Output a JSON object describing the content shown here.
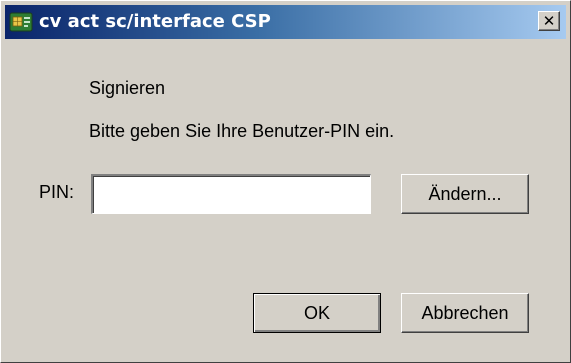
{
  "window": {
    "title": "cv act sc/interface CSP",
    "close_glyph": "✕"
  },
  "dialog": {
    "heading": "Signieren",
    "instruction": "Bitte geben Sie Ihre Benutzer-PIN ein.",
    "pin_label": "PIN:",
    "pin_value": "",
    "change_button": "Ändern...",
    "ok_button": "OK",
    "cancel_button": "Abbrechen"
  },
  "colors": {
    "face": "#d4d0c8",
    "titlebar_start": "#0a246a",
    "titlebar_end": "#a6caf0"
  },
  "icons": {
    "title": "smartcard-icon",
    "close": "close-icon"
  }
}
